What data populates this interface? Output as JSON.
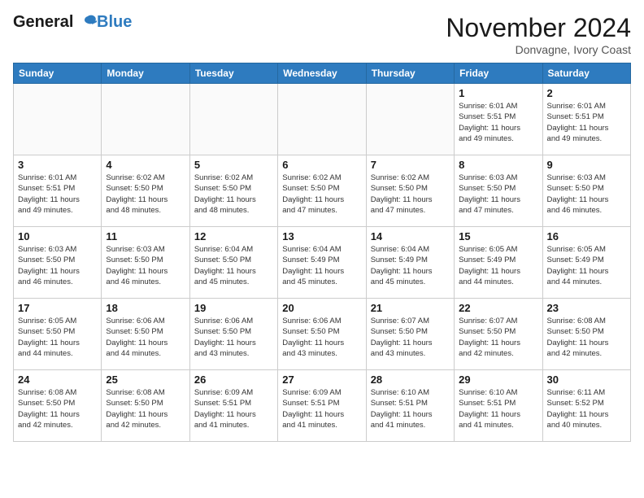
{
  "header": {
    "logo_line1": "General",
    "logo_line2": "Blue",
    "month": "November 2024",
    "location": "Donvagne, Ivory Coast"
  },
  "weekdays": [
    "Sunday",
    "Monday",
    "Tuesday",
    "Wednesday",
    "Thursday",
    "Friday",
    "Saturday"
  ],
  "weeks": [
    [
      {
        "day": "",
        "info": ""
      },
      {
        "day": "",
        "info": ""
      },
      {
        "day": "",
        "info": ""
      },
      {
        "day": "",
        "info": ""
      },
      {
        "day": "",
        "info": ""
      },
      {
        "day": "1",
        "info": "Sunrise: 6:01 AM\nSunset: 5:51 PM\nDaylight: 11 hours\nand 49 minutes."
      },
      {
        "day": "2",
        "info": "Sunrise: 6:01 AM\nSunset: 5:51 PM\nDaylight: 11 hours\nand 49 minutes."
      }
    ],
    [
      {
        "day": "3",
        "info": "Sunrise: 6:01 AM\nSunset: 5:51 PM\nDaylight: 11 hours\nand 49 minutes."
      },
      {
        "day": "4",
        "info": "Sunrise: 6:02 AM\nSunset: 5:50 PM\nDaylight: 11 hours\nand 48 minutes."
      },
      {
        "day": "5",
        "info": "Sunrise: 6:02 AM\nSunset: 5:50 PM\nDaylight: 11 hours\nand 48 minutes."
      },
      {
        "day": "6",
        "info": "Sunrise: 6:02 AM\nSunset: 5:50 PM\nDaylight: 11 hours\nand 47 minutes."
      },
      {
        "day": "7",
        "info": "Sunrise: 6:02 AM\nSunset: 5:50 PM\nDaylight: 11 hours\nand 47 minutes."
      },
      {
        "day": "8",
        "info": "Sunrise: 6:03 AM\nSunset: 5:50 PM\nDaylight: 11 hours\nand 47 minutes."
      },
      {
        "day": "9",
        "info": "Sunrise: 6:03 AM\nSunset: 5:50 PM\nDaylight: 11 hours\nand 46 minutes."
      }
    ],
    [
      {
        "day": "10",
        "info": "Sunrise: 6:03 AM\nSunset: 5:50 PM\nDaylight: 11 hours\nand 46 minutes."
      },
      {
        "day": "11",
        "info": "Sunrise: 6:03 AM\nSunset: 5:50 PM\nDaylight: 11 hours\nand 46 minutes."
      },
      {
        "day": "12",
        "info": "Sunrise: 6:04 AM\nSunset: 5:50 PM\nDaylight: 11 hours\nand 45 minutes."
      },
      {
        "day": "13",
        "info": "Sunrise: 6:04 AM\nSunset: 5:49 PM\nDaylight: 11 hours\nand 45 minutes."
      },
      {
        "day": "14",
        "info": "Sunrise: 6:04 AM\nSunset: 5:49 PM\nDaylight: 11 hours\nand 45 minutes."
      },
      {
        "day": "15",
        "info": "Sunrise: 6:05 AM\nSunset: 5:49 PM\nDaylight: 11 hours\nand 44 minutes."
      },
      {
        "day": "16",
        "info": "Sunrise: 6:05 AM\nSunset: 5:49 PM\nDaylight: 11 hours\nand 44 minutes."
      }
    ],
    [
      {
        "day": "17",
        "info": "Sunrise: 6:05 AM\nSunset: 5:50 PM\nDaylight: 11 hours\nand 44 minutes."
      },
      {
        "day": "18",
        "info": "Sunrise: 6:06 AM\nSunset: 5:50 PM\nDaylight: 11 hours\nand 44 minutes."
      },
      {
        "day": "19",
        "info": "Sunrise: 6:06 AM\nSunset: 5:50 PM\nDaylight: 11 hours\nand 43 minutes."
      },
      {
        "day": "20",
        "info": "Sunrise: 6:06 AM\nSunset: 5:50 PM\nDaylight: 11 hours\nand 43 minutes."
      },
      {
        "day": "21",
        "info": "Sunrise: 6:07 AM\nSunset: 5:50 PM\nDaylight: 11 hours\nand 43 minutes."
      },
      {
        "day": "22",
        "info": "Sunrise: 6:07 AM\nSunset: 5:50 PM\nDaylight: 11 hours\nand 42 minutes."
      },
      {
        "day": "23",
        "info": "Sunrise: 6:08 AM\nSunset: 5:50 PM\nDaylight: 11 hours\nand 42 minutes."
      }
    ],
    [
      {
        "day": "24",
        "info": "Sunrise: 6:08 AM\nSunset: 5:50 PM\nDaylight: 11 hours\nand 42 minutes."
      },
      {
        "day": "25",
        "info": "Sunrise: 6:08 AM\nSunset: 5:50 PM\nDaylight: 11 hours\nand 42 minutes."
      },
      {
        "day": "26",
        "info": "Sunrise: 6:09 AM\nSunset: 5:51 PM\nDaylight: 11 hours\nand 41 minutes."
      },
      {
        "day": "27",
        "info": "Sunrise: 6:09 AM\nSunset: 5:51 PM\nDaylight: 11 hours\nand 41 minutes."
      },
      {
        "day": "28",
        "info": "Sunrise: 6:10 AM\nSunset: 5:51 PM\nDaylight: 11 hours\nand 41 minutes."
      },
      {
        "day": "29",
        "info": "Sunrise: 6:10 AM\nSunset: 5:51 PM\nDaylight: 11 hours\nand 41 minutes."
      },
      {
        "day": "30",
        "info": "Sunrise: 6:11 AM\nSunset: 5:52 PM\nDaylight: 11 hours\nand 40 minutes."
      }
    ]
  ]
}
